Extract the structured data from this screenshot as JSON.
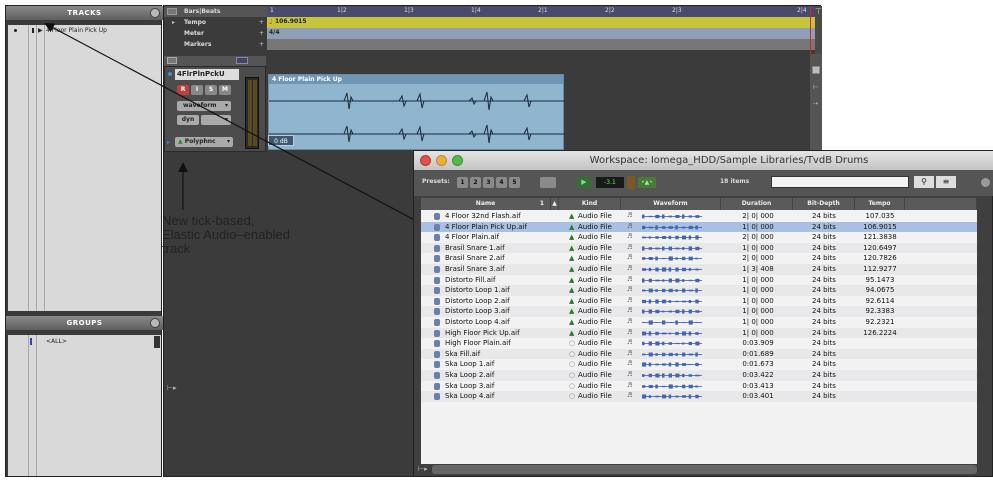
{
  "tracks_panel": {
    "title": "TRACKS",
    "track_name": "4 Floor Plain Pick Up"
  },
  "groups_panel": {
    "title": "GROUPS",
    "group_name": "<ALL>"
  },
  "edit_window": {
    "ruler_labels": [
      "Bars|Beats",
      "Tempo",
      "Meter",
      "Markers"
    ],
    "timeline_ticks": [
      "1",
      "1|2",
      "1|3",
      "1|4",
      "2|1",
      "2|2",
      "2|3",
      "2|4"
    ],
    "tempo_value": "106.9015",
    "meter_value": "4/4",
    "track": {
      "name": "4FlrPlnPckU",
      "buttons": [
        "R",
        "I",
        "S",
        "M"
      ],
      "view_menu": "waveform",
      "dyn_menu": "dyn",
      "elastic_mode": "Polyphnc"
    },
    "clip": {
      "name": "4 Floor Plain Pick Up",
      "gain": "0 dB"
    }
  },
  "workspace": {
    "title": "Workspace: Iomega_HDD/Sample Libraries/TvdB Drums",
    "presets_label": "Presets:",
    "preset_buttons": [
      "1",
      "2",
      "3",
      "4",
      "5"
    ],
    "level_value": "-3.1",
    "items_count": "18 items",
    "columns": [
      "Name",
      "1",
      "Kind",
      "Waveform",
      "Duration",
      "Bit-Depth",
      "Tempo"
    ],
    "rows": [
      {
        "name": "4 Floor 32nd Flash.aif",
        "kind": "Audio File",
        "duration": "2| 0| 000",
        "bitdepth": "24 bits",
        "tempo": "107.035",
        "elastic": true
      },
      {
        "name": "4 Floor Plain Pick Up.aif",
        "kind": "Audio File",
        "duration": "1| 0| 000",
        "bitdepth": "24 bits",
        "tempo": "106.9015",
        "elastic": true
      },
      {
        "name": "4 Floor Plain.aif",
        "kind": "Audio File",
        "duration": "2| 0| 000",
        "bitdepth": "24 bits",
        "tempo": "121.3838",
        "elastic": true
      },
      {
        "name": "Brasil Snare 1.aif",
        "kind": "Audio File",
        "duration": "1| 0| 000",
        "bitdepth": "24 bits",
        "tempo": "120.6497",
        "elastic": true
      },
      {
        "name": "Brasil Snare 2.aif",
        "kind": "Audio File",
        "duration": "2| 0| 000",
        "bitdepth": "24 bits",
        "tempo": "120.7826",
        "elastic": true
      },
      {
        "name": "Brasil Snare 3.aif",
        "kind": "Audio File",
        "duration": "1| 3| 408",
        "bitdepth": "24 bits",
        "tempo": "112.9277",
        "elastic": true
      },
      {
        "name": "Distorto Fill.aif",
        "kind": "Audio File",
        "duration": "1| 0| 000",
        "bitdepth": "24 bits",
        "tempo": "95.1473",
        "elastic": true
      },
      {
        "name": "Distorto Loop 1.aif",
        "kind": "Audio File",
        "duration": "1| 0| 000",
        "bitdepth": "24 bits",
        "tempo": "94.0675",
        "elastic": true
      },
      {
        "name": "Distorto Loop 2.aif",
        "kind": "Audio File",
        "duration": "1| 0| 000",
        "bitdepth": "24 bits",
        "tempo": "92.6114",
        "elastic": true
      },
      {
        "name": "Distorto Loop 3.aif",
        "kind": "Audio File",
        "duration": "1| 0| 000",
        "bitdepth": "24 bits",
        "tempo": "92.3383",
        "elastic": true
      },
      {
        "name": "Distorto Loop 4.aif",
        "kind": "Audio File",
        "duration": "1| 0| 000",
        "bitdepth": "24 bits",
        "tempo": "92.2321",
        "elastic": true
      },
      {
        "name": "High Floor Pick Up.aif",
        "kind": "Audio File",
        "duration": "1| 0| 000",
        "bitdepth": "24 bits",
        "tempo": "126.2224",
        "elastic": true
      },
      {
        "name": "High Floor Plain.aif",
        "kind": "Audio File",
        "duration": "0:03.909",
        "bitdepth": "24 bits",
        "tempo": "",
        "elastic": false
      },
      {
        "name": "Ska Fill.aif",
        "kind": "Audio File",
        "duration": "0:01.689",
        "bitdepth": "24 bits",
        "tempo": "",
        "elastic": false
      },
      {
        "name": "Ska Loop 1.aif",
        "kind": "Audio File",
        "duration": "0:01.673",
        "bitdepth": "24 bits",
        "tempo": "",
        "elastic": false
      },
      {
        "name": "Ska Loop 2.aif",
        "kind": "Audio File",
        "duration": "0:03.422",
        "bitdepth": "24 bits",
        "tempo": "",
        "elastic": false
      },
      {
        "name": "Ska Loop 3.aif",
        "kind": "Audio File",
        "duration": "0:03.413",
        "bitdepth": "24 bits",
        "tempo": "",
        "elastic": false
      },
      {
        "name": "Ska Loop 4.aif",
        "kind": "Audio File",
        "duration": "0:03.401",
        "bitdepth": "24 bits",
        "tempo": "",
        "elastic": false
      }
    ]
  },
  "annotation": {
    "lines": [
      "New tick-based,",
      "Elastic Audio–enabled",
      "track"
    ]
  }
}
